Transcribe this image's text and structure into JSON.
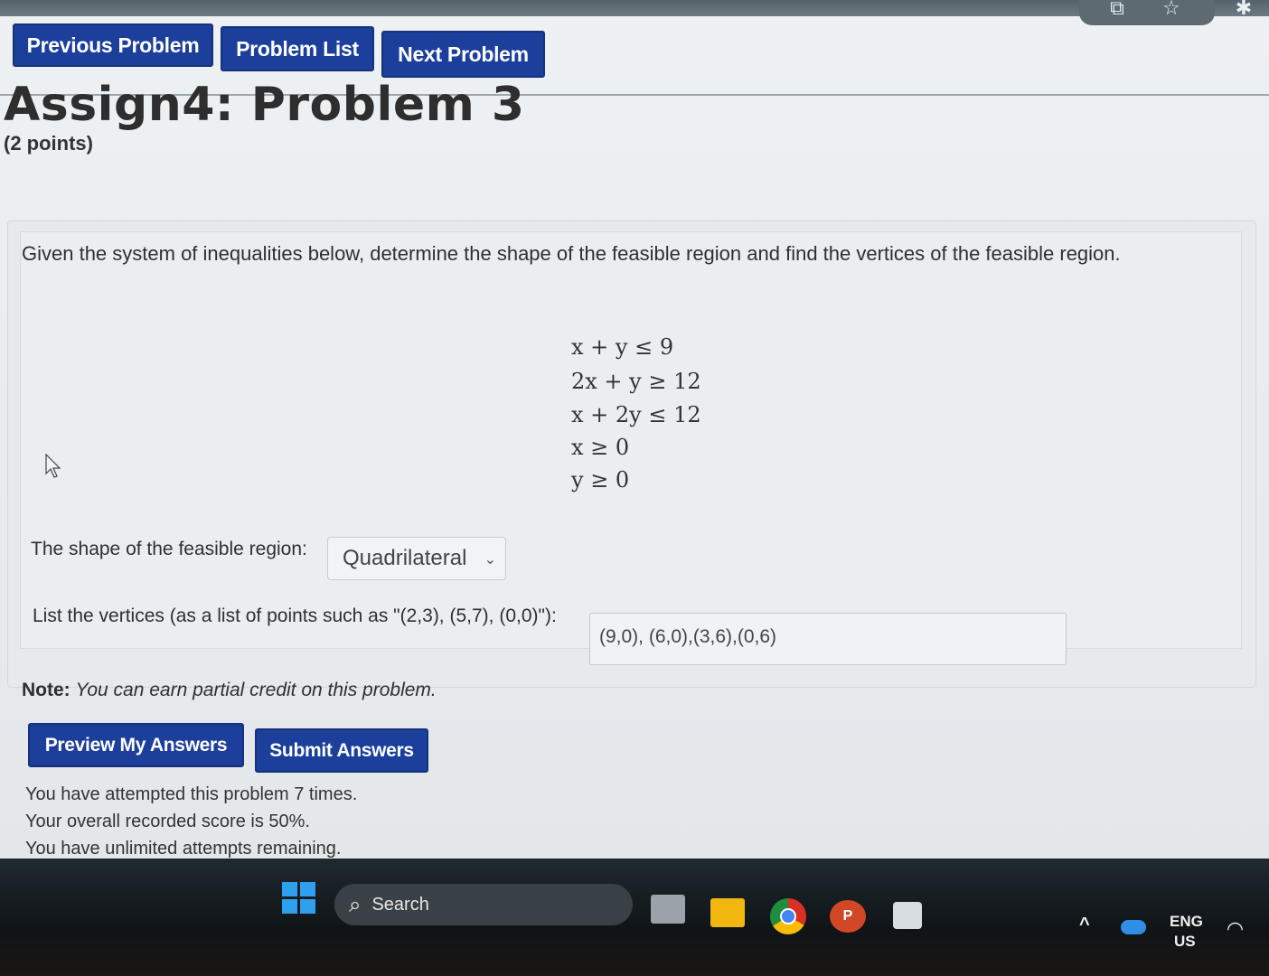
{
  "nav": {
    "previous_label": "Previous Problem",
    "list_label": "Problem List",
    "next_label": "Next Problem"
  },
  "problem": {
    "title": "Assign4: Problem 3",
    "points": "(2 points)",
    "prompt": "Given the system of inequalities below, determine the shape of the feasible region and find the vertices of the feasible region.",
    "inequalities": [
      "x + y ≤ 9",
      "2x + y ≥ 12",
      "x + 2y ≤ 12",
      "x ≥ 0",
      "y ≥ 0"
    ],
    "shape_label": "The shape of the feasible region:",
    "shape_value": "Quadrilateral",
    "vertices_label": "List the vertices (as a list of points such as \"(2,3), (5,7), (0,0)\"):",
    "vertices_value": "(9,0), (6,0),(3,6),(0,6)"
  },
  "note": {
    "label": "Note:",
    "text": "You can earn partial credit on this problem."
  },
  "actions": {
    "preview_label": "Preview My Answers",
    "submit_label": "Submit Answers"
  },
  "status": {
    "attempts": "You have attempted this problem 7 times.",
    "score": "Your overall recorded score is 50%.",
    "remaining": "You have unlimited attempts remaining."
  },
  "taskbar": {
    "search_placeholder": "Search",
    "lang_top": "ENG",
    "lang_bottom": "US"
  },
  "colors": {
    "button_blue": "#1c3f9c",
    "page_bg": "#e9edf0",
    "taskbar_bg": "#111618"
  }
}
